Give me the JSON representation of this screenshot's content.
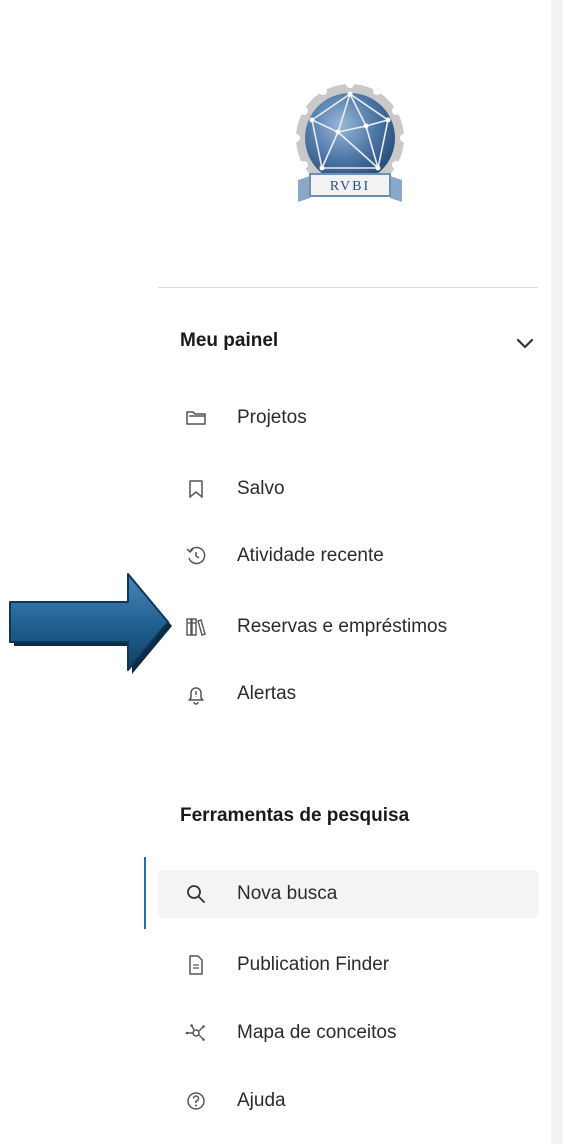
{
  "logo": {
    "text": "RVBI"
  },
  "panel": {
    "title": "Meu painel",
    "items": [
      {
        "label": "Projetos",
        "icon": "folder-icon"
      },
      {
        "label": "Salvo",
        "icon": "bookmark-icon"
      },
      {
        "label": "Atividade recente",
        "icon": "history-icon"
      },
      {
        "label": "Reservas e empréstimos",
        "icon": "books-icon"
      },
      {
        "label": "Alertas",
        "icon": "bell-icon"
      }
    ]
  },
  "tools": {
    "title": "Ferramentas de pesquisa",
    "items": [
      {
        "label": "Nova busca",
        "icon": "search-icon",
        "active": true
      },
      {
        "label": "Publication Finder",
        "icon": "document-icon"
      },
      {
        "label": "Mapa de conceitos",
        "icon": "concept-map-icon"
      },
      {
        "label": "Ajuda",
        "icon": "help-icon"
      }
    ]
  },
  "colors": {
    "arrow": "#1f5f8f",
    "active_bar": "#2c6e9c",
    "active_bg": "#f4f4f4"
  }
}
